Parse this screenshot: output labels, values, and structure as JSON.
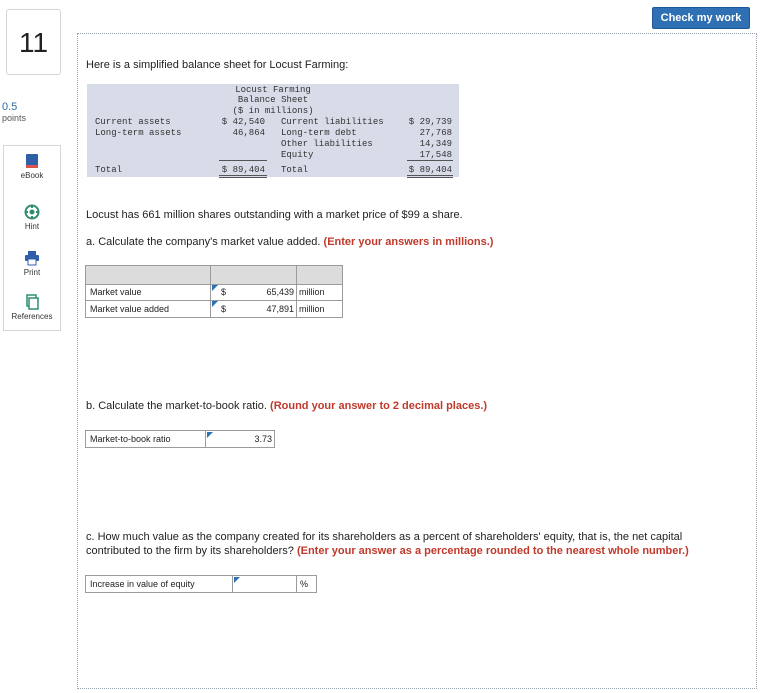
{
  "header": {
    "check_button": "Check my work"
  },
  "question": {
    "number": "11",
    "points_value": "0.5",
    "points_label": "points"
  },
  "tools": [
    {
      "label": "eBook",
      "icon": "ebook-icon"
    },
    {
      "label": "Hint",
      "icon": "hint-icon"
    },
    {
      "label": "Print",
      "icon": "print-icon"
    },
    {
      "label": "References",
      "icon": "references-icon"
    }
  ],
  "prompt": "Here is a simplified balance sheet for Locust Farming:",
  "balance_sheet": {
    "title": "Locust Farming",
    "subtitle": "Balance Sheet",
    "units": "($ in millions)",
    "left_rows": [
      {
        "label": "Current assets",
        "value": "$ 42,540"
      },
      {
        "label": "Long-term assets",
        "value": "46,864"
      }
    ],
    "right_rows": [
      {
        "label": "Current liabilities",
        "value": "$ 29,739"
      },
      {
        "label": "Long-term debt",
        "value": "27,768"
      },
      {
        "label": "Other liabilities",
        "value": "14,349"
      },
      {
        "label": "Equity",
        "value": "17,548"
      }
    ],
    "total_left_label": "Total",
    "total_left_value": "$ 89,404",
    "total_right_label": "Total",
    "total_right_value": "$ 89,404"
  },
  "info": "Locust has 661 million shares outstanding with a market price of $99 a share.",
  "part_a": {
    "text": "a. Calculate the company's market value added.",
    "instruction": "(Enter your answers in millions.)",
    "rows": [
      {
        "label": "Market value",
        "currency": "$",
        "value": "65,439",
        "unit": "million"
      },
      {
        "label": "Market value added",
        "currency": "$",
        "value": "47,891",
        "unit": "million"
      }
    ]
  },
  "part_b": {
    "text": "b. Calculate the market-to-book ratio.",
    "instruction": "(Round your answer to 2 decimal places.)",
    "label": "Market-to-book ratio",
    "value": "3.73"
  },
  "part_c": {
    "text_line1": "c. How much value as the company created for its shareholders as a percent of shareholders' equity, that is, the net capital",
    "text_line2": "contributed to the firm by its shareholders?",
    "instruction": "(Enter your answer as a percentage rounded to the nearest whole number.)",
    "label": "Increase in value of equity",
    "value": "",
    "unit": "%"
  }
}
